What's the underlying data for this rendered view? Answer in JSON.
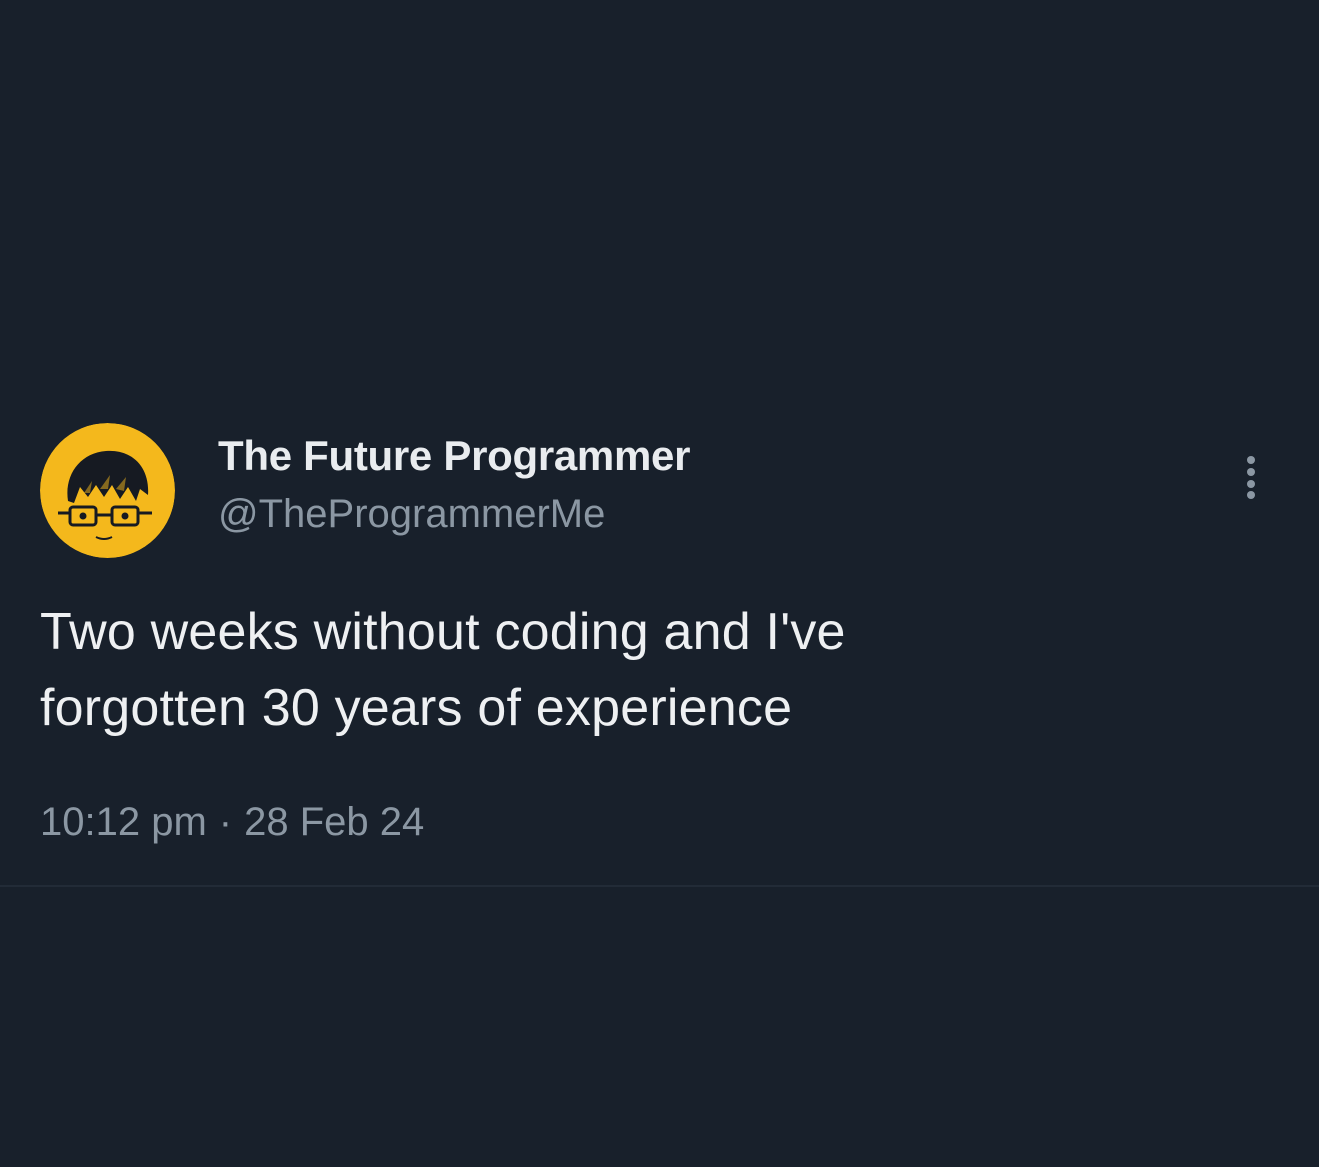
{
  "tweet": {
    "display_name": "The Future Programmer",
    "handle": "@TheProgrammerMe",
    "text_line1": "Two weeks without coding and I've",
    "text_line2": "forgotten 30 years of experience",
    "time": "10:12 pm",
    "separator": "·",
    "date": "28 Feb 24"
  },
  "avatar": {
    "icon": "programmer-avatar-icon",
    "background_color": "#f4b81c"
  },
  "menu": {
    "icon": "more-options-icon"
  },
  "colors": {
    "background": "#18202b",
    "primary_text": "#e9ecef",
    "secondary_text": "#8b97a3"
  }
}
